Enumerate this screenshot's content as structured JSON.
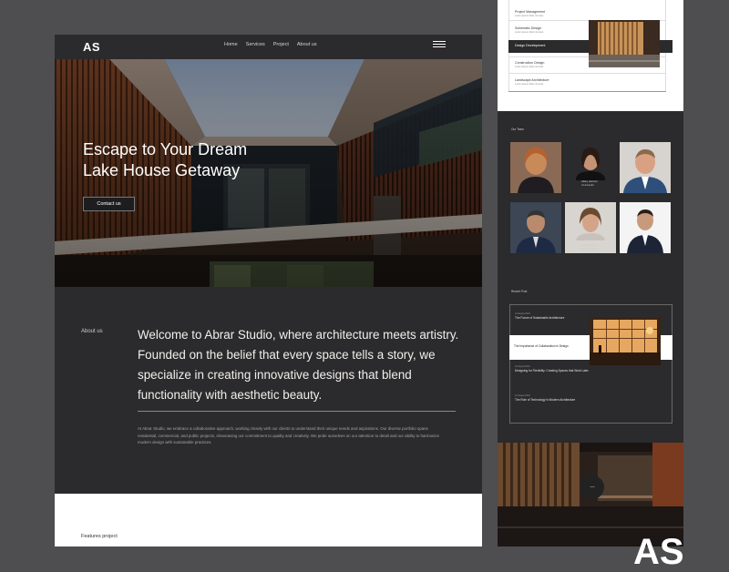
{
  "nav": {
    "logo": "AS",
    "links": [
      "Home",
      "Services",
      "Project",
      "About us"
    ]
  },
  "hero": {
    "title_line1": "Escape to Your Dream",
    "title_line2": "Lake House Getaway",
    "cta": "Contact us"
  },
  "about": {
    "label": "About us",
    "heading": "Welcome to Abrar Studio, where architecture meets artistry. Founded on the belief that every space tells a story, we specialize in creating innovative designs that blend functionality with aesthetic beauty.",
    "body": "At Abrar Studio, we embrace a collaborative approach, working closely with our clients to understand their unique needs and aspirations. Our diverse portfolio spans residential, commercial, and public projects, showcasing our commitment to quality and creativity. We pride ourselves on our attention to detail and our ability to harmonize modern design with sustainable practices."
  },
  "featured": {
    "label": "Features project"
  },
  "services_preview": {
    "items": [
      {
        "title": "Project Management",
        "sub": "Lorem ipsum dolor sit amet"
      },
      {
        "title": "Schematic Design",
        "sub": "Lorem ipsum dolor sit amet"
      },
      {
        "title": "Design Development",
        "sub": "Lorem ipsum dolor sit amet"
      },
      {
        "title": "Construction Design",
        "sub": "Lorem ipsum dolor sit amet"
      },
      {
        "title": "Landscape Architecture",
        "sub": "Lorem ipsum dolor sit amet"
      }
    ]
  },
  "team": {
    "label": "Our Team",
    "captions": [
      {
        "name": "Hillary Hatchett",
        "role": "Co-Founder"
      },
      {
        "name": "Ethan Ramirez",
        "role": "Senior Architect"
      }
    ]
  },
  "blog": {
    "label": "Recent Post",
    "posts": [
      {
        "date": "12 August 2024",
        "title": "The Future of Sustainable Architecture"
      },
      {
        "date": "12 August 2024",
        "title": "The Importance of Collaboration in Design"
      },
      {
        "date": "12 August 2024",
        "title": "Designing for Flexibility: Creating Spaces that Work Later"
      },
      {
        "date": "12 August 2024",
        "title": "The Role of Technology in Modern Architecture"
      }
    ]
  },
  "footer_preview": {
    "letters": "AS",
    "play": "—"
  },
  "colors": {
    "dark": "#2b2a2c",
    "backdrop": "#4e4d4f",
    "wood": "#7a4a30",
    "white": "#ffffff"
  }
}
